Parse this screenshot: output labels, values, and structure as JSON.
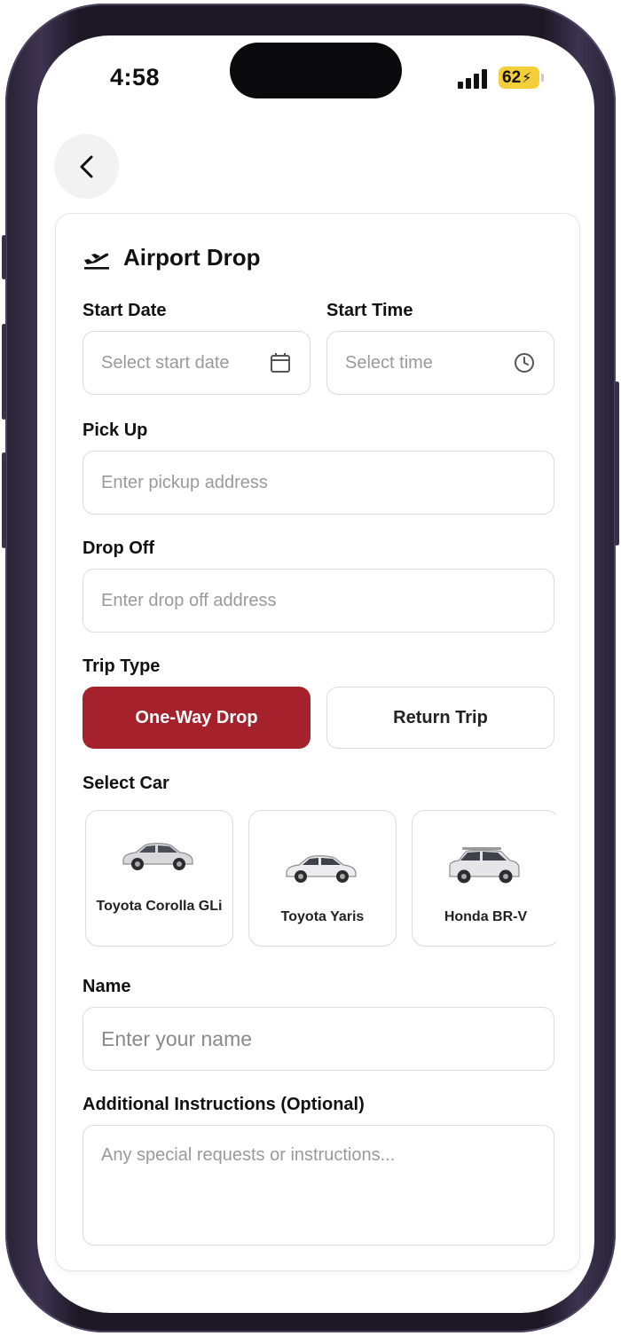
{
  "status_bar": {
    "time": "4:58",
    "battery": "62"
  },
  "page": {
    "title": "Airport Drop",
    "start_date": {
      "label": "Start Date",
      "placeholder": "Select start date"
    },
    "start_time": {
      "label": "Start Time",
      "placeholder": "Select time"
    },
    "pickup": {
      "label": "Pick Up",
      "placeholder": "Enter pickup address"
    },
    "dropoff": {
      "label": "Drop Off",
      "placeholder": "Enter drop off address"
    },
    "trip_type": {
      "label": "Trip Type",
      "options": [
        "One-Way Drop",
        "Return Trip"
      ],
      "selected": "One-Way Drop",
      "accent_color": "#a5222c"
    },
    "select_car": {
      "label": "Select Car",
      "cars": [
        {
          "name": "Toyota Corolla GLi"
        },
        {
          "name": "Toyota Yaris"
        },
        {
          "name": "Honda BR-V"
        }
      ]
    },
    "name": {
      "label": "Name",
      "placeholder": "Enter your name"
    },
    "instructions": {
      "label": "Additional Instructions (Optional)",
      "placeholder": "Any special requests or instructions..."
    }
  }
}
